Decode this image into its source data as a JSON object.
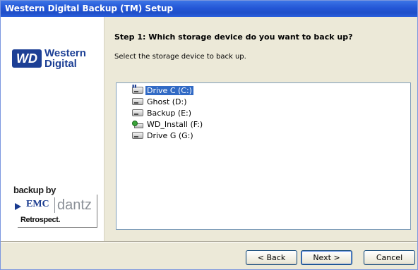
{
  "window": {
    "title": "Western Digital Backup (TM) Setup"
  },
  "sidebar": {
    "wd_logo_badge": "WD",
    "wd_logo_line1": "Western",
    "wd_logo_line2": "Digital",
    "backup_by": "backup by",
    "emc": "EMC",
    "dantz": "dantz",
    "retrospect": "Retrospect."
  },
  "main": {
    "step_title": "Step 1: Which storage device do you want to back up?",
    "step_description": "Select the storage device to back up.",
    "drives": [
      {
        "label": "Drive C (C:)",
        "icon": "system-drive-icon",
        "selected": true
      },
      {
        "label": "Ghost (D:)",
        "icon": "hard-drive-icon",
        "selected": false
      },
      {
        "label": "Backup (E:)",
        "icon": "hard-drive-icon",
        "selected": false
      },
      {
        "label": "WD_Install (F:)",
        "icon": "network-drive-icon",
        "selected": false
      },
      {
        "label": "Drive G (G:)",
        "icon": "hard-drive-icon",
        "selected": false
      }
    ]
  },
  "buttons": {
    "back": "< Back",
    "next": "Next >",
    "cancel": "Cancel"
  },
  "colors": {
    "titlebar": "#2456d6",
    "selection": "#316ac5",
    "dialog_bg": "#ece9d8",
    "wd_blue": "#1c3f95"
  }
}
